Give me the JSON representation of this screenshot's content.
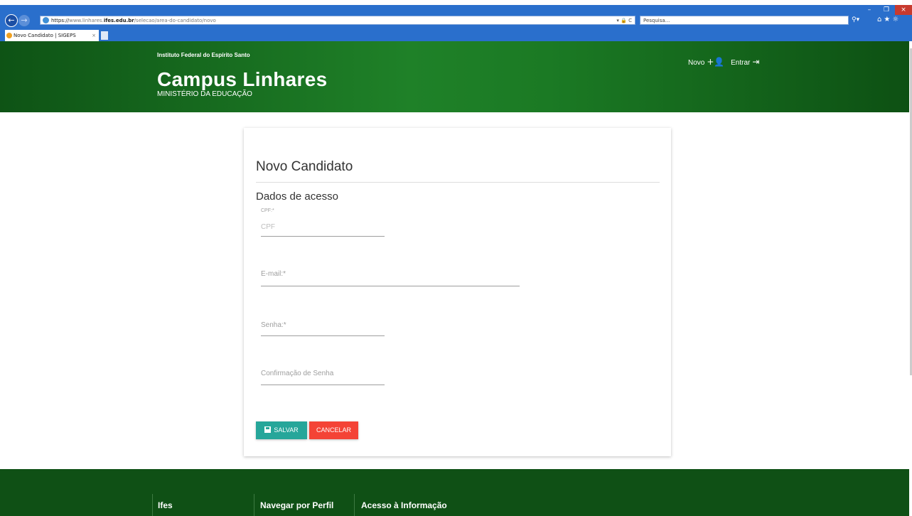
{
  "browser": {
    "url_scheme": "https://",
    "url_prefix": "www.linhares.",
    "url_host": "ifes.edu.br",
    "url_path": "/selecao/area-do-candidato/novo",
    "search_placeholder": "Pesquisa...",
    "tab_title": "Novo Candidato | SIGEPS",
    "back_icon": "←",
    "forward_icon": "→",
    "address_icons": "▾ 🔒 C",
    "search_icon": "⚲▾",
    "toolbar_icons": "⌂★☼",
    "tab_close": "×",
    "minimize": "–",
    "maximize": "❐",
    "close": "×"
  },
  "header": {
    "institute": "Instituto Federal do Espírito Santo",
    "campus": "Campus Linhares",
    "ministry": "MINISTÉRIO DA EDUCAÇÃO",
    "nav": {
      "new_label": "Novo",
      "new_icon": "+👤",
      "login_label": "Entrar",
      "login_icon": "⇥"
    }
  },
  "form": {
    "title": "Novo Candidato",
    "section": "Dados de acesso",
    "cpf_label": "CPF:*",
    "cpf_placeholder": "CPF",
    "email_label": "E-mail:*",
    "password_label": "Senha:*",
    "confirm_label": "Confirmação de Senha",
    "save_label": "SALVAR",
    "cancel_label": "CANCELAR"
  },
  "footer": {
    "columns": [
      "Ifes",
      "Navegar por Perfil",
      "Acesso à Informação"
    ]
  },
  "colors": {
    "header_green": "#1f8128",
    "footer_green": "#0f5015",
    "save_button": "#26a69a",
    "cancel_button": "#f44336"
  }
}
